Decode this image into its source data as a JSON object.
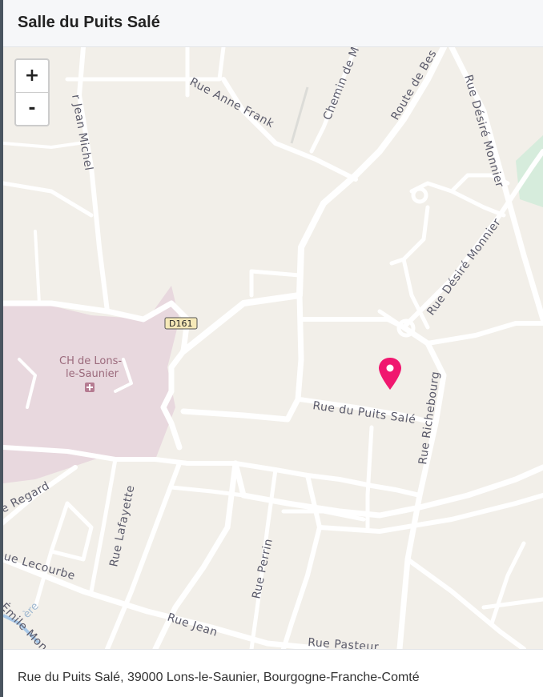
{
  "header": {
    "title": "Salle du Puits Salé"
  },
  "map": {
    "zoom_in_label": "+",
    "zoom_out_label": "-",
    "labels": {
      "jean_michel": "r Jean Michel",
      "anne_frank": "Rue Anne Frank",
      "chemin_de_m": "Chemin de M",
      "route_de_bes": "Route de Bes",
      "desire_monnier_1": "Rue Désiré Monnier",
      "desire_monnier_2": "Rue Désiré Monnier",
      "d161": "D161",
      "hospital_1": "CH de Lons-",
      "hospital_2": "le-Saunier",
      "puits_sale": "Rue du Puits Salé",
      "richebourg": "Rue Richebourg",
      "regard": "e Regard",
      "lafayette": "Rue Lafayette",
      "lecourbe": "ue Lecourbe",
      "perrin": "Rue Perrin",
      "jean": "Rue Jean",
      "pasteur": "Rue Pasteur",
      "emile_mon": "Émile Mon",
      "vallee": "ère"
    },
    "colors": {
      "background": "#f2efe9",
      "road": "#ffffff",
      "hospital": "#e8d8de",
      "park": "#d6ecdc",
      "marker": "#f0176f"
    },
    "marker_icon": "map-pin-icon"
  },
  "footer": {
    "address": "Rue du Puits Salé, 39000 Lons-le-Saunier, Bourgogne-Franche-Comté"
  }
}
